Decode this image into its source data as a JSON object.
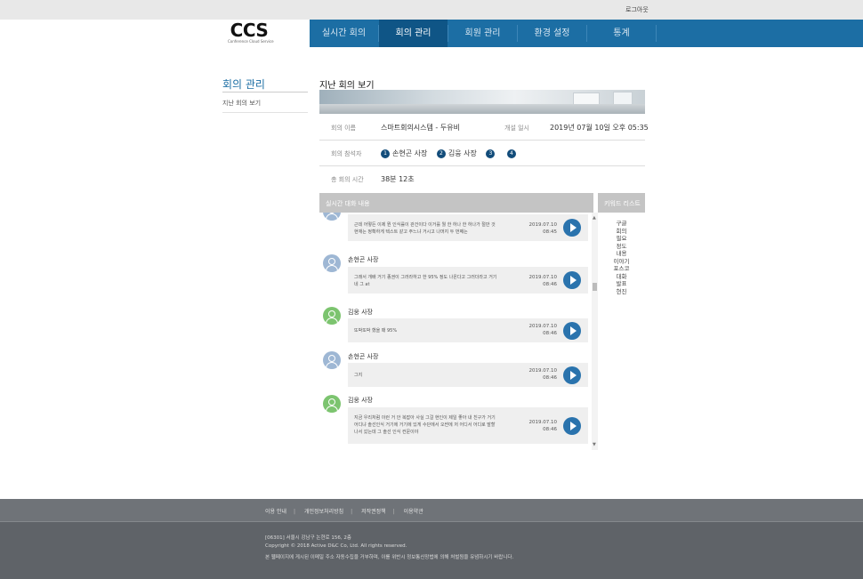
{
  "topbar": {
    "logout": "로그아웃"
  },
  "logo": {
    "main": "CCS",
    "sub": "Conference Cloud Service"
  },
  "nav": {
    "items": [
      "실시간 회의",
      "회의 관리",
      "회원 관리",
      "환경 설정",
      "통계"
    ],
    "active_index": 1
  },
  "sidebar": {
    "title": "회의 관리",
    "items": [
      "지난 회의 보기"
    ]
  },
  "main": {
    "title": "지난 회의 보기",
    "meeting_name_label": "회의 이름",
    "meeting_name": "스마트회의시스템 - 두유비",
    "opened_label": "개설 일시",
    "opened": "2019년 07월 10일 오후 05:35",
    "participants_label": "회의 참석자",
    "participants": [
      {
        "num": "1",
        "name": "손현곤 사장"
      },
      {
        "num": "2",
        "name": "김웅 사장"
      },
      {
        "num": "3",
        "name": ""
      },
      {
        "num": "4",
        "name": ""
      }
    ],
    "duration_label": "총 회의 시간",
    "duration": "38분 12초"
  },
  "chat": {
    "header": "실시간 대화 내용",
    "messages": [
      {
        "speaker": "",
        "avatar": "blue",
        "line1": "근데 어떻든 이제 뭔 인식률이 관건이다 이거를 뭘 한 하나 한 하나가 절만 것",
        "line2": "현재는 정확하게 텍스트 같고 주느냐 거시고 나머지 두 번째는",
        "date": "2019.07.10",
        "time": "08:45"
      },
      {
        "speaker": "손현곤 사장",
        "avatar": "blue",
        "line1": "그래서 개배 거기 종권이 그러라하고 한 95% 정도 나온다고 그러더라고 거기",
        "line2": "네 그 at",
        "date": "2019.07.10",
        "time": "08:46"
      },
      {
        "speaker": "김웅 사장",
        "avatar": "green",
        "line1": "또박또박 했을 때 95%",
        "line2": "",
        "date": "2019.07.10",
        "time": "08:46"
      },
      {
        "speaker": "손현곤 사장",
        "avatar": "blue",
        "line1": "그지",
        "line2": "",
        "date": "2019.07.10",
        "time": "08:46"
      },
      {
        "speaker": "김웅 사장",
        "avatar": "green",
        "line1": "지금 우리처럼 이런 거 안 복잡아 사실 그걸 현인이 제일 좋아 내 친구가 거기",
        "line2": "어디냐 솔선인식 거기에 거기에 있게 수단에서 오썬에 저 어디서 어디로 발할",
        "line3": "나서 갔는데 그 솔선 인식 컨문이야",
        "date": "2019.07.10",
        "time": "08:46"
      }
    ]
  },
  "keywords": {
    "header": "키워드 리스트",
    "items": [
      "구글",
      "회의",
      "필요",
      "정도",
      "내용",
      "이야기",
      "포스코",
      "대화",
      "발표",
      "현진"
    ]
  },
  "footer": {
    "links": [
      "이용 안내",
      "개인정보처리방침",
      "저작권정책",
      "이용약관"
    ],
    "address": "[06301] 서울시 강남구 논현로 156, 2층",
    "copyright": "Copyright © 2018 Active D&C Co, Ltd. All rights reserved.",
    "notice": "본 웹페이지에 게시된 이메일 주소 자동수집을 거부하며, 이를 위반시 정보통신망법에 의해 처벌됨을 유념하시기 바랍니다."
  }
}
